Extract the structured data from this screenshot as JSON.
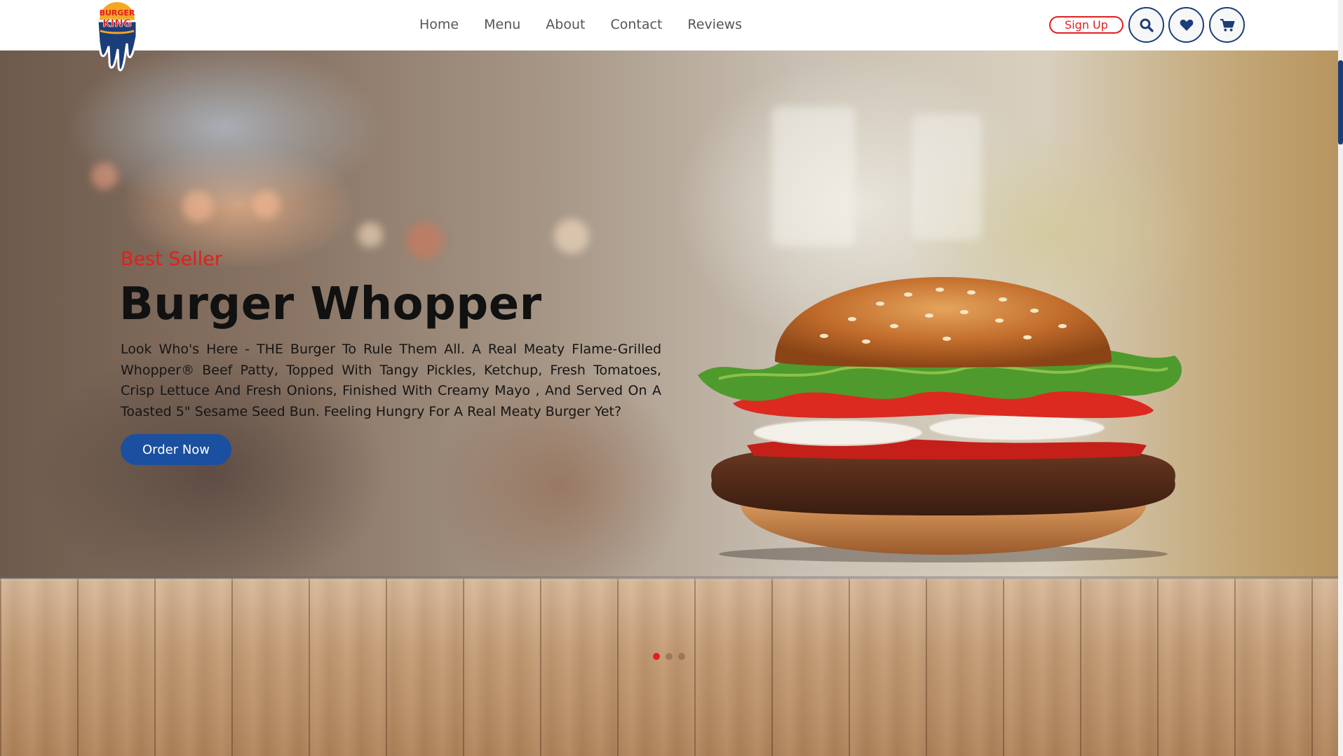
{
  "brand": {
    "logo_text_line1": "BURGER",
    "logo_text_line2": "KING",
    "colors": {
      "red": "#e0201e",
      "blue": "#1b4fa0",
      "navy": "#1b3d7a",
      "orange": "#f5a623"
    }
  },
  "nav": {
    "links": [
      "Home",
      "Menu",
      "About",
      "Contact",
      "Reviews"
    ]
  },
  "header_actions": {
    "signup_label": "Sign Up",
    "icons": [
      "search-icon",
      "heart-icon",
      "cart-icon"
    ]
  },
  "hero": {
    "kicker": "Best Seller",
    "title": "Burger Whopper",
    "description": "Look Who's Here - THE Burger To Rule Them All. A Real Meaty Flame-Grilled Whopper® Beef Patty, Topped With Tangy Pickles, Ketchup, Fresh Tomatoes, Crisp Lettuce And Fresh Onions, Finished With Creamy Mayo , And Served On A Toasted 5\" Sesame Seed Bun. Feeling Hungry For A Real Meaty Burger Yet?",
    "cta_label": "Order Now"
  },
  "carousel": {
    "slide_count": 3,
    "active_index": 0
  }
}
